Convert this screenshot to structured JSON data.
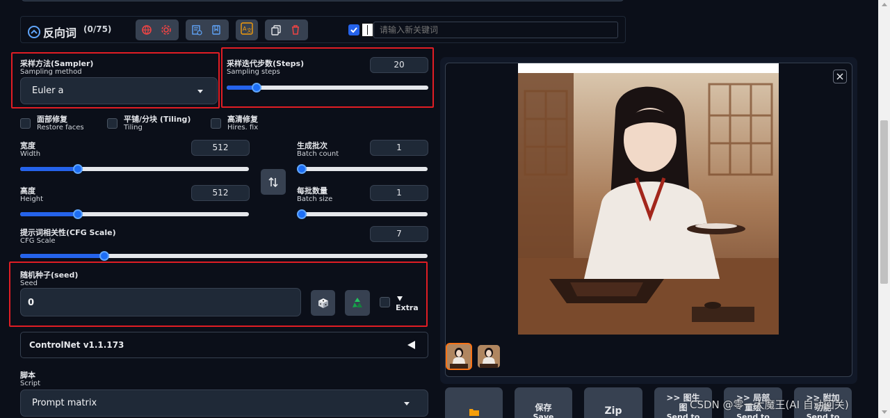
{
  "negative_prompt": {
    "title": "反向词",
    "count": "(0/75)",
    "keyword_placeholder": "请输入新关键词"
  },
  "sampler": {
    "label_cn": "采样方法(Sampler)",
    "label_en": "Sampling method",
    "value": "Euler a"
  },
  "steps": {
    "label_cn": "采样迭代步数(Steps)",
    "label_en": "Sampling steps",
    "value": "20",
    "fraction": 0.13
  },
  "checkboxes": [
    {
      "cn": "面部修复",
      "en": "Restore faces"
    },
    {
      "cn": "平铺/分块 (Tiling)",
      "en": "Tiling"
    },
    {
      "cn": "高清修复",
      "en": "Hires. fix"
    }
  ],
  "width": {
    "label_cn": "宽度",
    "label_en": "Width",
    "value": "512",
    "fraction": 0.24
  },
  "height": {
    "label_cn": "高度",
    "label_en": "Height",
    "value": "512",
    "fraction": 0.24
  },
  "batch_count": {
    "label_cn": "生成批次",
    "label_en": "Batch count",
    "value": "1",
    "fraction": 0.0
  },
  "batch_size": {
    "label_cn": "每批数量",
    "label_en": "Batch size",
    "value": "1",
    "fraction": 0.0
  },
  "cfg": {
    "label_cn": "提示词相关性(CFG Scale)",
    "label_en": "CFG Scale",
    "value": "7",
    "fraction": 0.2
  },
  "seed": {
    "label_cn": "随机种子(seed)",
    "label_en": "Seed",
    "value": "0",
    "extra_label": "Extra"
  },
  "controlnet": {
    "label": "ControlNet v1.1.173"
  },
  "script": {
    "label_cn": "脚本",
    "label_en": "Script",
    "value": "Prompt matrix"
  },
  "output_buttons": {
    "save_cn": "保存",
    "save_en": "Save",
    "zip": "Zip",
    "to_img2img_cn": ">> 图生图",
    "to_inpaint_cn": ">> 局部重绘",
    "to_extras_cn": ">> 附加功能",
    "send_to": "Send to"
  },
  "watermark": "CSDN @零一大魔王(AI 自动回关)",
  "colors": {
    "background": "#0b0f19",
    "panel": "#1f2937",
    "accent": "#2563eb",
    "highlight_frame": "#e11d24",
    "selected_thumb": "#f97316"
  }
}
